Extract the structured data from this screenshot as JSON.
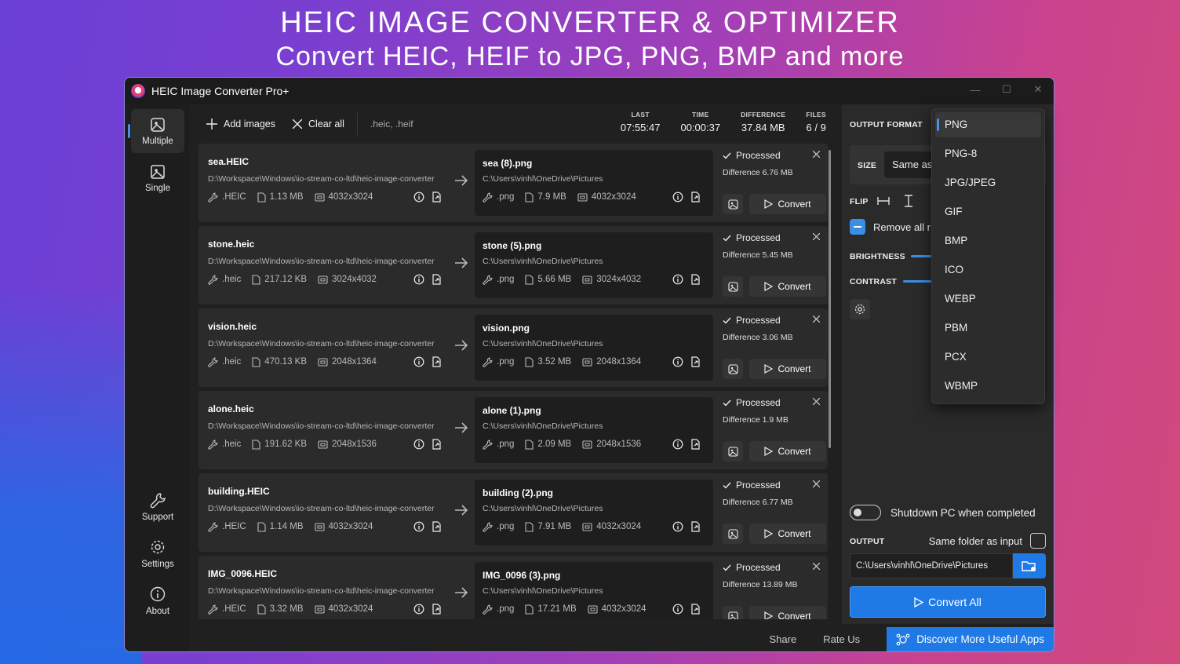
{
  "banner": {
    "title": "HEIC IMAGE CONVERTER & OPTIMIZER",
    "subtitle": "Convert HEIC, HEIF to JPG, PNG, BMP and more"
  },
  "window": {
    "title": "HEIC Image Converter Pro+"
  },
  "nav": {
    "multiple": "Multiple",
    "single": "Single",
    "support": "Support",
    "settings": "Settings",
    "about": "About"
  },
  "toolbar": {
    "add_images": "Add images",
    "clear_all": "Clear all",
    "extensions": ".heic, .heif",
    "stats": [
      {
        "label": "LAST",
        "value": "07:55:47"
      },
      {
        "label": "TIME",
        "value": "00:00:37"
      },
      {
        "label": "DIFFERENCE",
        "value": "37.84 MB"
      },
      {
        "label": "FILES",
        "value": "6 / 9"
      }
    ]
  },
  "items": [
    {
      "src_name": "sea.HEIC",
      "src_path": "D:\\Workspace\\Windows\\io-stream-co-ltd\\heic-image-converter",
      "src_ext": ".HEIC",
      "src_size": "1.13 MB",
      "src_dim": "4032x3024",
      "dst_name": "sea (8).png",
      "dst_path": "C:\\Users\\vinhl\\OneDrive\\Pictures",
      "dst_ext": ".png",
      "dst_size": "7.9 MB",
      "dst_dim": "4032x3024",
      "status": "Processed",
      "difference": "Difference 6.76 MB",
      "convert": "Convert"
    },
    {
      "src_name": "stone.heic",
      "src_path": "D:\\Workspace\\Windows\\io-stream-co-ltd\\heic-image-converter",
      "src_ext": ".heic",
      "src_size": "217.12 KB",
      "src_dim": "3024x4032",
      "dst_name": "stone (5).png",
      "dst_path": "C:\\Users\\vinhl\\OneDrive\\Pictures",
      "dst_ext": ".png",
      "dst_size": "5.66 MB",
      "dst_dim": "3024x4032",
      "status": "Processed",
      "difference": "Difference 5.45 MB",
      "convert": "Convert"
    },
    {
      "src_name": "vision.heic",
      "src_path": "D:\\Workspace\\Windows\\io-stream-co-ltd\\heic-image-converter",
      "src_ext": ".heic",
      "src_size": "470.13 KB",
      "src_dim": "2048x1364",
      "dst_name": "vision.png",
      "dst_path": "C:\\Users\\vinhl\\OneDrive\\Pictures",
      "dst_ext": ".png",
      "dst_size": "3.52 MB",
      "dst_dim": "2048x1364",
      "status": "Processed",
      "difference": "Difference 3.06 MB",
      "convert": "Convert"
    },
    {
      "src_name": "alone.heic",
      "src_path": "D:\\Workspace\\Windows\\io-stream-co-ltd\\heic-image-converter",
      "src_ext": ".heic",
      "src_size": "191.62 KB",
      "src_dim": "2048x1536",
      "dst_name": "alone (1).png",
      "dst_path": "C:\\Users\\vinhl\\OneDrive\\Pictures",
      "dst_ext": ".png",
      "dst_size": "2.09 MB",
      "dst_dim": "2048x1536",
      "status": "Processed",
      "difference": "Difference 1.9 MB",
      "convert": "Convert"
    },
    {
      "src_name": "building.HEIC",
      "src_path": "D:\\Workspace\\Windows\\io-stream-co-ltd\\heic-image-converter",
      "src_ext": ".HEIC",
      "src_size": "1.14 MB",
      "src_dim": "4032x3024",
      "dst_name": "building (2).png",
      "dst_path": "C:\\Users\\vinhl\\OneDrive\\Pictures",
      "dst_ext": ".png",
      "dst_size": "7.91 MB",
      "dst_dim": "4032x3024",
      "status": "Processed",
      "difference": "Difference 6.77 MB",
      "convert": "Convert"
    },
    {
      "src_name": "IMG_0096.HEIC",
      "src_path": "D:\\Workspace\\Windows\\io-stream-co-ltd\\heic-image-converter",
      "src_ext": ".HEIC",
      "src_size": "3.32 MB",
      "src_dim": "4032x3024",
      "dst_name": "IMG_0096 (3).png",
      "dst_path": "C:\\Users\\vinhl\\OneDrive\\Pictures",
      "dst_ext": ".png",
      "dst_size": "17.21 MB",
      "dst_dim": "4032x3024",
      "status": "Processed",
      "difference": "Difference 13.89 MB",
      "convert": "Convert"
    }
  ],
  "panel": {
    "output_format_label": "OUTPUT FORMAT",
    "size_label": "SIZE",
    "size_value": "Same as",
    "flip_label": "FLIP",
    "remove_label": "Remove all r",
    "brightness_label": "BRIGHTNESS",
    "contrast_label": "CONTRAST",
    "shutdown_label": "Shutdown PC when completed",
    "output_label": "OUTPUT",
    "same_folder_label": "Same folder as input",
    "output_path": "C:\\Users\\vinhl\\OneDrive\\Pictures",
    "convert_all": "Convert All"
  },
  "formats": [
    "PNG",
    "PNG-8",
    "JPG/JPEG",
    "GIF",
    "BMP",
    "ICO",
    "WEBP",
    "PBM",
    "PCX",
    "WBMP"
  ],
  "selected_format": "PNG",
  "footer": {
    "share": "Share",
    "rate": "Rate Us",
    "discover": "Discover More Useful Apps"
  },
  "colors": {
    "accent": "#1f7ae6",
    "background": "#202020",
    "card": "#2b2b2b"
  }
}
